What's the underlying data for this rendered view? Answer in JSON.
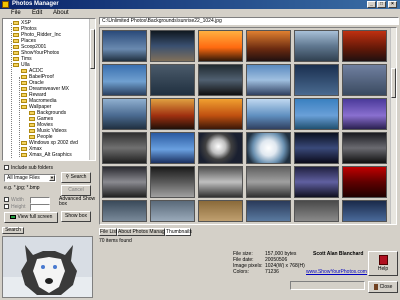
{
  "window": {
    "title": "Photos Manager"
  },
  "menu": {
    "file": "File",
    "edit": "Edit",
    "about": "About"
  },
  "tree": {
    "items": [
      "XSP",
      "Photos",
      "Photo_Ridder_Inc",
      "Places",
      "Scoop2001",
      "ShowYourPhotos",
      "Tims",
      "Ulla",
      "ACDC",
      "BabelProof",
      "Oracle",
      "Dreamweaver MX",
      "Reward",
      "Macromedia",
      "Wallpaper",
      "Backgrounds",
      "Games",
      "Movies",
      "Music Videos",
      "People",
      "Windows xp 2002 dvd",
      "Xmax",
      "Xmas_Alt Graphics"
    ]
  },
  "controls": {
    "include_sub": "Include sub folders",
    "filter_value": "All Image Files",
    "search_label": "Search",
    "search_value": "e.g. *.jpg; *.bmp",
    "cancel_label": "Cancel",
    "width_label": "Width",
    "height_label": "Height",
    "adv_label": "Advanced Show box",
    "view_full": "View full screen",
    "show_box": "Show box",
    "bottom_tab": "Search"
  },
  "path": "C:\\Unlimited Photos\\Backgrounds\\sunrise22_1024.jpg",
  "tabs": [
    "File List",
    "About Photos Manager",
    "Thumbnails"
  ],
  "status": "70 items found",
  "info": {
    "file_size_label": "File size:",
    "file_size": "157,000 bytes",
    "file_date_label": "File date:",
    "file_date": "20050506",
    "pixels_label": "Image pixels:",
    "pixels": "1024(W) x 768(H)",
    "colors_label": "Colors:",
    "colors": "71236"
  },
  "author": "Scott Alan Blanchard",
  "website": "www.ShowYourPhotos.com",
  "buttons": {
    "help": "Help",
    "close": "Close"
  }
}
